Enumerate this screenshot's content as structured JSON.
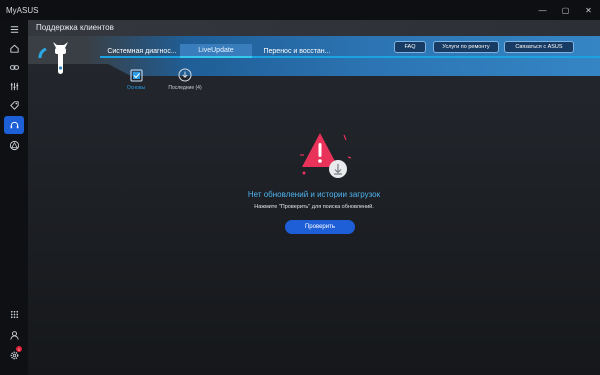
{
  "window": {
    "title": "MyASUS",
    "controls": [
      "—",
      "▢",
      "✕"
    ]
  },
  "sidebar": {
    "items": [
      {
        "name": "menu",
        "icon": "hamburger-icon"
      },
      {
        "name": "home",
        "icon": "home-icon"
      },
      {
        "name": "link",
        "icon": "link-icon"
      },
      {
        "name": "customize",
        "icon": "sliders-icon"
      },
      {
        "name": "offers",
        "icon": "tag-icon"
      },
      {
        "name": "support",
        "icon": "headset-icon",
        "active": true
      },
      {
        "name": "store",
        "icon": "triangle-icon"
      }
    ],
    "bottom": [
      {
        "name": "apps",
        "icon": "grid-icon"
      },
      {
        "name": "account",
        "icon": "user-icon"
      },
      {
        "name": "settings",
        "icon": "gear-icon",
        "badge": "1"
      }
    ]
  },
  "header": {
    "title": "Поддержка клиентов",
    "tabs": [
      {
        "label": "Системная диагнос...",
        "active": false
      },
      {
        "label": "LiveUpdate",
        "active": true
      },
      {
        "label": "Перенос и восстан...",
        "active": false
      }
    ],
    "buttons": {
      "faq": "FAQ",
      "repair": "Услуги по ремонту",
      "contact": "Связаться с ASUS"
    }
  },
  "subnav": {
    "items": [
      {
        "label": "Основы",
        "icon": "checkbox-icon",
        "active": true
      },
      {
        "label": "Последние (4)",
        "icon": "download-circle-icon",
        "active": false
      }
    ]
  },
  "empty_state": {
    "title": "Нет обновлений и истории загрузок",
    "hint": "Нажмите \"Проверить\" для поиска обновлений.",
    "button": "Проверить"
  },
  "colors": {
    "accent": "#1e5fd8",
    "banner": "#2c74b3",
    "warning": "#e8325a",
    "title_text": "#4fb3f0"
  }
}
